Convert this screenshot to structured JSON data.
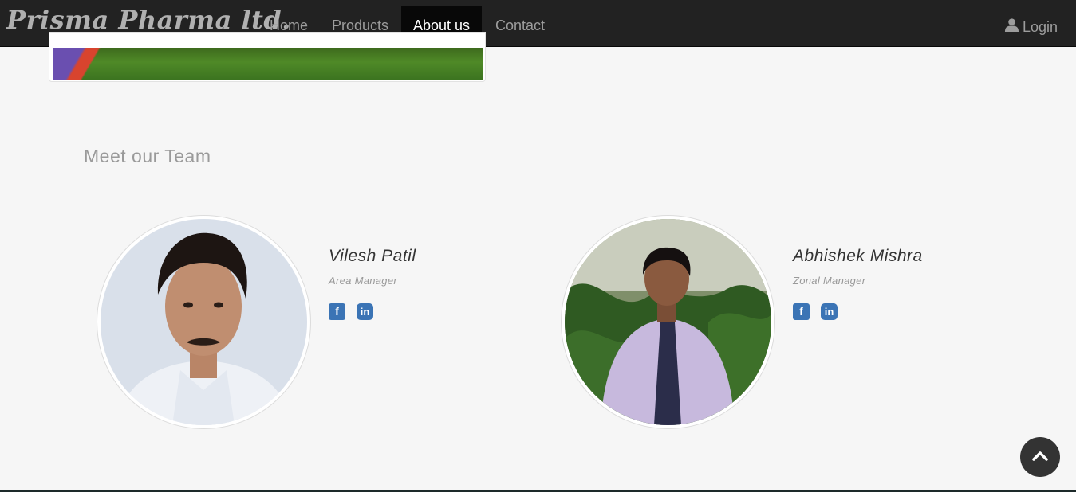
{
  "brand": "Prisma Pharma ltd.",
  "nav": {
    "items": [
      {
        "label": "Home"
      },
      {
        "label": "Products"
      },
      {
        "label": "About us",
        "active": true
      },
      {
        "label": "Contact"
      }
    ],
    "login_label": "Login",
    "login_icon": "user-icon"
  },
  "team": {
    "title": "Meet our Team",
    "members": [
      {
        "name": "Vilesh Patil",
        "role": "Area Manager",
        "social": [
          "facebook-icon",
          "linkedin-icon"
        ]
      },
      {
        "name": "Abhishek Mishra",
        "role": "Zonal Manager",
        "social": [
          "facebook-icon",
          "linkedin-icon"
        ]
      }
    ]
  },
  "back_to_top_icon": "chevron-up-icon",
  "colors": {
    "navbar": "#222222",
    "active_nav": "#080808",
    "social_blue": "#3b74b5",
    "background": "#f6f6f6"
  }
}
